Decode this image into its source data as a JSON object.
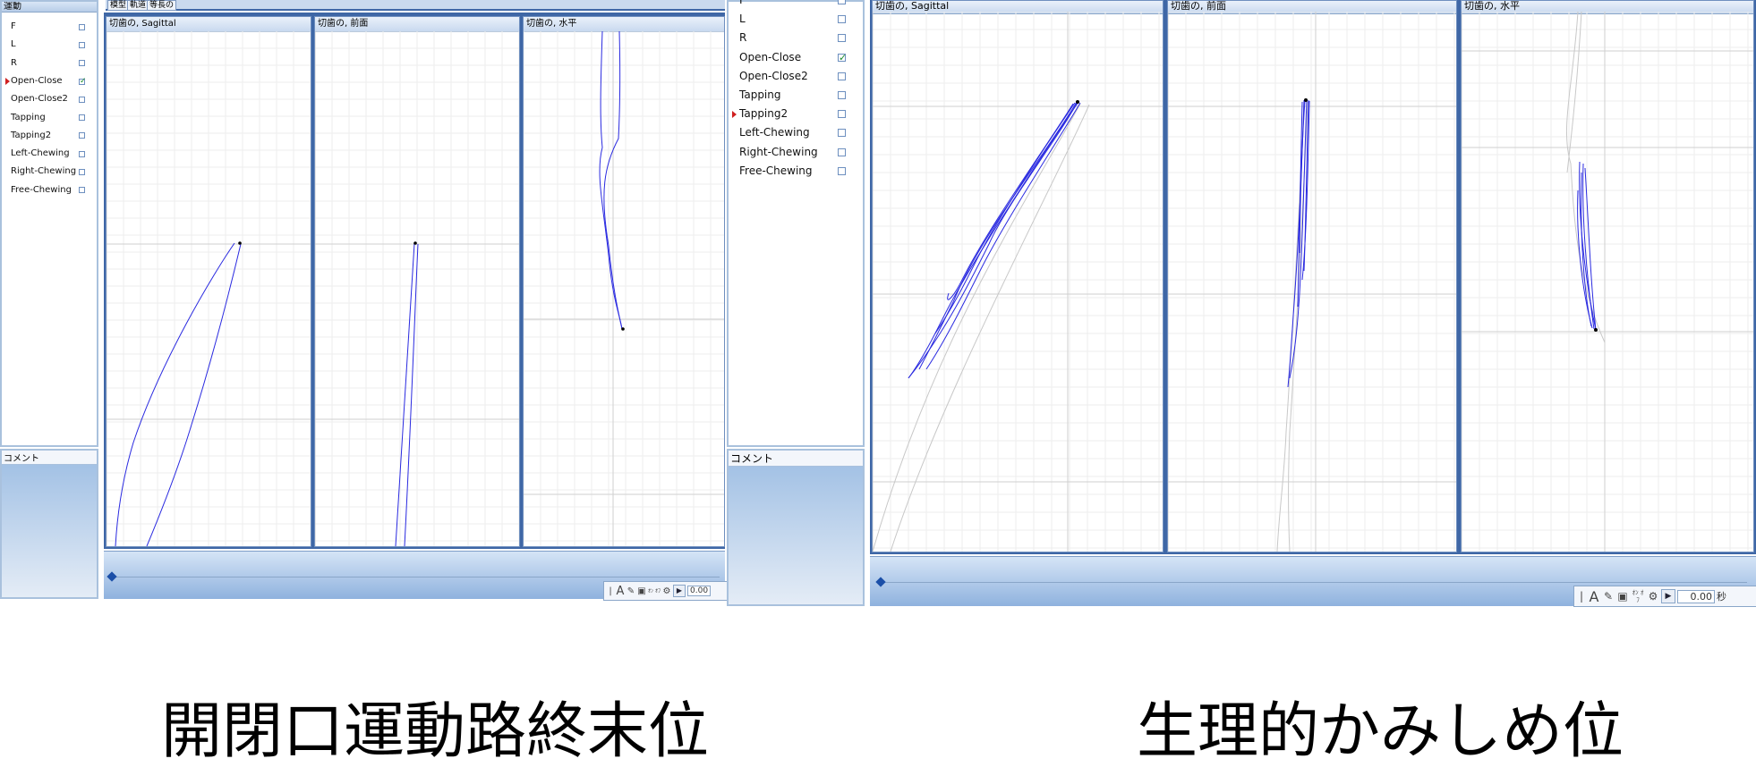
{
  "left": {
    "motion_header": "運動",
    "toolbar_tabs": [
      "模型",
      "軌道",
      "等長の"
    ],
    "motions": [
      {
        "label": "F",
        "checked": false,
        "selected": false
      },
      {
        "label": "L",
        "checked": false,
        "selected": false
      },
      {
        "label": "R",
        "checked": false,
        "selected": false
      },
      {
        "label": "Open-Close",
        "checked": true,
        "selected": true
      },
      {
        "label": "Open-Close2",
        "checked": false,
        "selected": false
      },
      {
        "label": "Tapping",
        "checked": false,
        "selected": false
      },
      {
        "label": "Tapping2",
        "checked": false,
        "selected": false
      },
      {
        "label": "Left-Chewing",
        "checked": false,
        "selected": false
      },
      {
        "label": "Right-Chewing",
        "checked": false,
        "selected": false
      },
      {
        "label": "Free-Chewing",
        "checked": false,
        "selected": false
      }
    ],
    "comment_label": "コメント",
    "views": [
      {
        "title": "切歯の, Sagittal"
      },
      {
        "title": "切歯の, 前面"
      },
      {
        "title": "切歯の, 水平"
      }
    ],
    "time_value": "0.00"
  },
  "right": {
    "motions": [
      {
        "label": "F",
        "checked": false,
        "selected": false
      },
      {
        "label": "L",
        "checked": false,
        "selected": false
      },
      {
        "label": "R",
        "checked": false,
        "selected": false
      },
      {
        "label": "Open-Close",
        "checked": true,
        "selected": false
      },
      {
        "label": "Open-Close2",
        "checked": false,
        "selected": false
      },
      {
        "label": "Tapping",
        "checked": false,
        "selected": false
      },
      {
        "label": "Tapping2",
        "checked": false,
        "selected": true
      },
      {
        "label": "Left-Chewing",
        "checked": false,
        "selected": false
      },
      {
        "label": "Right-Chewing",
        "checked": false,
        "selected": false
      },
      {
        "label": "Free-Chewing",
        "checked": false,
        "selected": false
      }
    ],
    "comment_label": "コメント",
    "views": [
      {
        "title": "切歯の, Sagittal"
      },
      {
        "title": "切歯の, 前面"
      },
      {
        "title": "切歯の, 水平"
      }
    ],
    "time_value": "0.00",
    "time_unit": "秒"
  },
  "toolbar_icons": [
    "cursor-bar-icon",
    "text-a-icon",
    "edit-note-icon",
    "record-icon",
    "toggle-on-off-icon",
    "settings-gear-icon"
  ],
  "toolbar_toggle_text": "ｵﾝ ｵﾌ",
  "captions": {
    "left": "開閉口運動路終末位",
    "right": "生理的かみしめ位"
  },
  "colors": {
    "trace": "#2a2ae0",
    "ghost_trace": "#c8c8c8",
    "panel_border": "#a9c1dd",
    "check_green": "#1a8a2e",
    "selected_marker": "#d02020"
  }
}
